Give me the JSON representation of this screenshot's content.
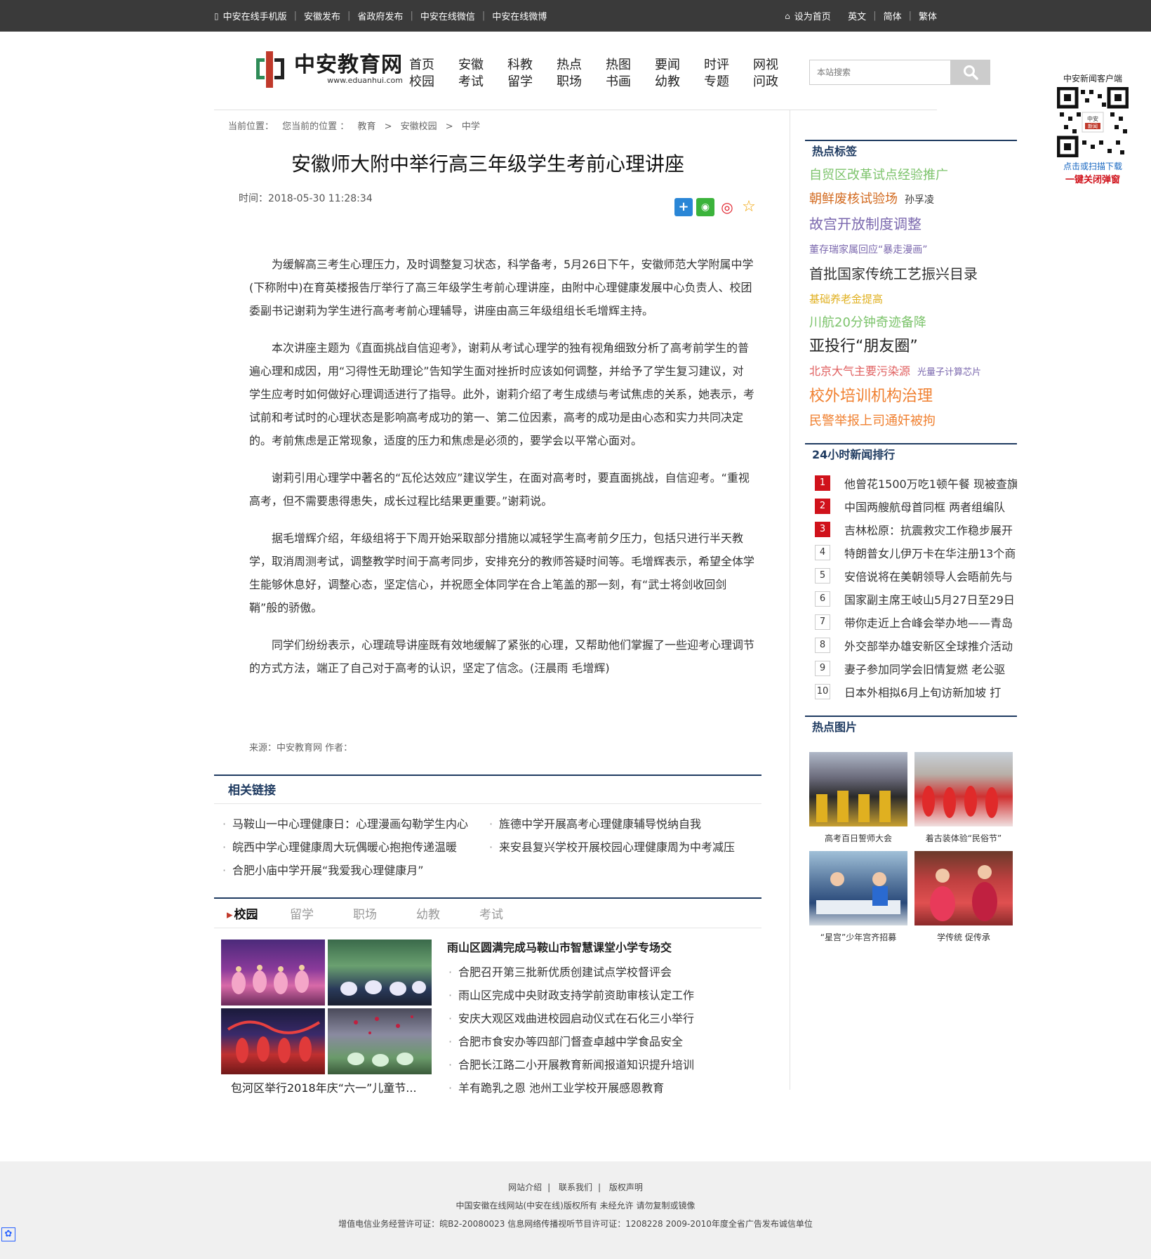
{
  "topbar": {
    "left": [
      "中安在线手机版",
      "安徽发布",
      "省政府发布",
      "中安在线微信",
      "中安在线微博"
    ],
    "right": [
      "设为首页",
      "英文",
      "简体",
      "繁体"
    ]
  },
  "logo": {
    "cn": "中安教育网",
    "en": "www.eduanhui.com"
  },
  "nav": [
    [
      "首页",
      "校园"
    ],
    [
      "安徽",
      "考试"
    ],
    [
      "科教",
      "留学"
    ],
    [
      "热点",
      "职场"
    ],
    [
      "热图",
      "书画"
    ],
    [
      "要闻",
      "幼教"
    ],
    [
      "时评",
      "专题"
    ],
    [
      "网视",
      "问政"
    ]
  ],
  "search": {
    "placeholder": "本站搜索"
  },
  "breadcrumb": [
    "当前位置：",
    "您当前的位置 ：",
    "教育",
    ">",
    "安徽校园",
    ">",
    "中学"
  ],
  "article": {
    "title": "安徽师大附中举行高三年级学生考前心理讲座",
    "time": "时间：2018-05-30 11:28:34",
    "paragraphs": [
      "为缓解高三考生心理压力，及时调整复习状态，科学备考，5月26日下午，安徽师范大学附属中学(下称附中)在育英楼报告厅举行了高三年级学生考前心理讲座，由附中心理健康发展中心负责人、校团委副书记谢莉为学生进行高考考前心理辅导，讲座由高三年级组组长毛增辉主持。",
      "本次讲座主题为《直面挑战自信迎考》，谢莉从考试心理学的独有视角细致分析了高考前学生的普遍心理和成因，用“习得性无助理论”告知学生面对挫折时应该如何调整，并给予了学生复习建议，对学生应考时如何做好心理调适进行了指导。此外，谢莉介绍了考生成绩与考试焦虑的关系，她表示，考试前和考试时的心理状态是影响高考成功的第一、第二位因素，高考的成功是由心态和实力共同决定的。考前焦虑是正常现象，适度的压力和焦虑是必须的，要学会以平常心面对。",
      "谢莉引用心理学中著名的“瓦伦达效应”建议学生，在面对高考时，要直面挑战，自信迎考。“重视高考，但不需要患得患失，成长过程比结果更重要。”谢莉说。",
      "据毛增辉介绍，年级组将于下周开始采取部分措施以减轻学生高考前夕压力，包括只进行半天教学，取消周测考试，调整教学时间于高考同步，安排充分的教师答疑时间等。毛增辉表示，希望全体学生能够休息好，调整心态，坚定信心，并祝愿全体同学在合上笔盖的那一刻，有“武士将剑收回剑鞘”般的骄傲。",
      "同学们纷纷表示，心理疏导讲座既有效地缓解了紧张的心理，又帮助他们掌握了一些迎考心理调节的方式方法，端正了自己对于高考的认识，坚定了信念。(汪晨雨 毛增辉)"
    ],
    "source": "来源：中安教育网   作者："
  },
  "related": {
    "title": "相关链接",
    "items": [
      "马鞍山一中心理健康日：心理漫画勾勒学生内心",
      "旌德中学开展高考心理健康辅导悦纳自我",
      "皖西中学心理健康周大玩偶暖心抱抱传递温暖",
      "来安县复兴学校开展校园心理健康周为中考减压",
      "合肥小庙中学开展“我爱我心理健康月”"
    ]
  },
  "tabs": [
    "校园",
    "留学",
    "职场",
    "幼教",
    "考试"
  ],
  "campus": {
    "pic_caption": "包河区举行2018年庆“六一”儿童节...",
    "headline": "雨山区圆满完成马鞍山市智慧课堂小学专场交",
    "items": [
      "合肥召开第三批新优质创建试点学校督评会",
      "雨山区完成中央财政支持学前资助审核认定工作",
      "安庆大观区戏曲进校园启动仪式在石化三小举行",
      "合肥市食安办等四部门督查卓越中学食品安全",
      "合肥长江路二小开展教育新闻报道知识提升培训",
      "羊有跪乳之恩 池州工业学校开展感恩教育"
    ]
  },
  "sidebar": {
    "hot_tags_title": "热点标签",
    "tags": [
      [
        {
          "t": "自贸区改革试点经验推广",
          "c": "#7cc36b",
          "s": 18
        }
      ],
      [
        {
          "t": "朝鲜废核试验场",
          "c": "#d2691e",
          "s": 18
        },
        {
          "t": "孙孚凌",
          "c": "#333333",
          "s": 14
        }
      ],
      [
        {
          "t": "故宫开放制度调整",
          "c": "#7b68ae",
          "s": 20
        }
      ],
      [
        {
          "t": "董存瑞家属回应“暴走漫画”",
          "c": "#7b68ae",
          "s": 14
        }
      ],
      [
        {
          "t": "首批国家传统工艺振兴目录",
          "c": "#333333",
          "s": 20
        }
      ],
      [
        {
          "t": "基础养老金提高",
          "c": "#e0b020",
          "s": 15
        }
      ],
      [
        {
          "t": "川航20分钟奇迹备降",
          "c": "#7cc36b",
          "s": 18
        }
      ],
      [
        {
          "t": "亚投行“朋友圈”",
          "c": "#222222",
          "s": 22
        }
      ],
      [
        {
          "t": "北京大气主要污染源",
          "c": "#e06060",
          "s": 16
        },
        {
          "t": "光量子计算芯片",
          "c": "#7b68ae",
          "s": 13
        }
      ],
      [
        {
          "t": "校外培训机构治理",
          "c": "#f08030",
          "s": 22
        }
      ],
      [
        {
          "t": "民警举报上司通奸被拘",
          "c": "#f08030",
          "s": 18
        }
      ]
    ],
    "rank_title": "24小时新闻排行",
    "rank": [
      "他曾花1500万吃1顿午餐 现被查旗",
      "中国两艘航母首同框 两者组编队",
      "吉林松原：抗震救灾工作稳步展开",
      "特朗普女儿伊万卡在华注册13个商",
      "安倍说将在美朝领导人会晤前先与",
      "国家副主席王岐山5月27日至29日",
      "带你走近上合峰会举办地——青岛",
      "外交部举办雄安新区全球推介活动",
      "妻子参加同学会旧情复燃 老公驱",
      "日本外相拟6月上旬访新加坡 打"
    ],
    "hot_pics_title": "热点图片",
    "hot_pics": [
      "高考百日誓师大会",
      "着古装体验“民俗节”",
      "“星宫”少年宫齐招募",
      "学传统 促传承"
    ]
  },
  "qr": {
    "title": "中安新闻客户端",
    "line1": "点击或扫描下载",
    "line2": "一键关闭弹窗"
  },
  "footer": {
    "links": [
      "网站介绍",
      "联系我们",
      "版权声明"
    ],
    "line2": "中国安徽在线网站(中安在线)版权所有 未经允许 请勿复制或镜像",
    "line3": "增值电信业务经营许可证：皖B2-20080023 信息网络传播视听节目许可证：1208228   2009-2010年度全省广告发布诚信单位"
  }
}
